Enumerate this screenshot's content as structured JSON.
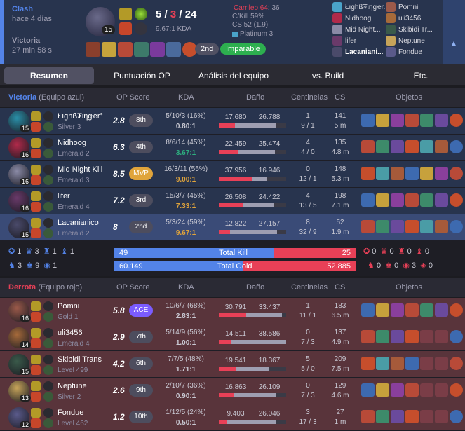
{
  "header": {
    "queue": "Clash",
    "time_ago": "hace 4 días",
    "result": "Victoria",
    "duration": "27 min 58 s",
    "kills": "5",
    "deaths": "3",
    "assists": "24",
    "kda_ratio": "9.67:1 KDA",
    "level": "15",
    "position_badge": "2nd",
    "tag": "Imparable",
    "kill_participation_label": "Carrileo 64",
    "kill_participation_value": ": 36",
    "ck": "C/Kill 59%",
    "cs": "CS 52 (1.9)",
    "rank": "Platinum 3",
    "players_left": [
      "Łıghß₮ιηgҽr...",
      "Nidhoog",
      "Mid Night...",
      "lifer",
      "Lacaniani..."
    ],
    "players_right": [
      "Pomni",
      "uli3456",
      "Skibidi Tr...",
      "Neptune",
      "Fondue"
    ]
  },
  "tabs": [
    "Resumen",
    "Puntuación OP",
    "Análisis del equipo",
    "vs. Build",
    "Etc."
  ],
  "columns": {
    "op": "OP Score",
    "kda": "KDA",
    "damage": "Daño",
    "wards": "Centinelas",
    "cs": "CS",
    "items": "Objetos"
  },
  "blue_team": {
    "label": "Victoria",
    "sub": "(Equipo azul)",
    "players": [
      {
        "name": "Łıghß₮ιηgҽr°",
        "rank": "Silver 3",
        "level": "15",
        "score": "2.8",
        "badge": "8th",
        "kda": "5/10/3 (16%)",
        "ratio": "0.80:1",
        "dealt": "17.680",
        "taken": "26.788",
        "dealt_pct": 0.47,
        "taken_pct": 0.71,
        "wards": "1",
        "wards2": "9 / 1",
        "cs": "141",
        "cspm": "5 m"
      },
      {
        "name": "Nidhoog",
        "rank": "Emerald 2",
        "level": "16",
        "score": "6.3",
        "badge": "4th",
        "kda": "8/6/14 (45%)",
        "ratio": "3.67:1",
        "dealt": "22.459",
        "taken": "25.474",
        "dealt_pct": 0.59,
        "taken_pct": 0.66,
        "wards": "4",
        "wards2": "4 / 0",
        "cs": "135",
        "cspm": "4.8 m"
      },
      {
        "name": "Mid Night Kill",
        "rank": "Emerald 3",
        "level": "16",
        "score": "8.5",
        "badge": "MVP",
        "kda": "16/3/11 (55%)",
        "ratio": "9.00:1",
        "dealt": "37.956",
        "taken": "16.946",
        "dealt_pct": 1.0,
        "taken_pct": 0.44,
        "wards": "0",
        "wards2": "12 / 1",
        "cs": "148",
        "cspm": "5.3 m"
      },
      {
        "name": "lifer",
        "rank": "Emerald 4",
        "level": "16",
        "score": "7.2",
        "badge": "3rd",
        "kda": "15/3/7 (45%)",
        "ratio": "7.33:1",
        "dealt": "26.508",
        "taken": "24.422",
        "dealt_pct": 0.7,
        "taken_pct": 0.64,
        "wards": "4",
        "wards2": "13 / 5",
        "cs": "198",
        "cspm": "7.1 m"
      },
      {
        "name": "Lacanianico",
        "rank": "Emerald 2",
        "level": "15",
        "score": "8",
        "badge": "2nd",
        "kda": "5/3/24 (59%)",
        "ratio": "9.67:1",
        "dealt": "12.822",
        "taken": "27.157",
        "dealt_pct": 0.34,
        "taken_pct": 0.72,
        "wards": "8",
        "wards2": "32 / 9",
        "cs": "52",
        "cspm": "1.9 m"
      }
    ]
  },
  "summary": {
    "total_kill_label": "Total Kill",
    "blue_kills": "49",
    "red_kills": "25",
    "kill_ratio": 0.662,
    "total_gold_label": "Total Gold",
    "blue_gold": "60.149",
    "red_gold": "52.885",
    "gold_ratio": 0.532,
    "blue_obj_top": [
      "1",
      "3",
      "1",
      "1"
    ],
    "blue_obj_bot": [
      "3",
      "9",
      "1"
    ],
    "red_obj_top": [
      "0",
      "0",
      "0",
      "0"
    ],
    "red_obj_bot": [
      "0",
      "0",
      "3",
      "0"
    ]
  },
  "red_team": {
    "label": "Derrota",
    "sub": "(Equipo rojo)",
    "players": [
      {
        "name": "Pomni",
        "rank": "Gold 1",
        "level": "16",
        "score": "5.8",
        "badge": "ACE",
        "kda": "10/6/7 (68%)",
        "ratio": "2.83:1",
        "dealt": "30.791",
        "taken": "33.437",
        "dealt_pct": 0.81,
        "taken_pct": 0.88,
        "wards": "1",
        "wards2": "11 / 1",
        "cs": "183",
        "cspm": "6.5 m"
      },
      {
        "name": "uli3456",
        "rank": "Emerald 4",
        "level": "14",
        "score": "2.9",
        "badge": "7th",
        "kda": "5/14/9 (56%)",
        "ratio": "1.00:1",
        "dealt": "14.511",
        "taken": "38.586",
        "dealt_pct": 0.38,
        "taken_pct": 1.0,
        "wards": "0",
        "wards2": "7 / 3",
        "cs": "137",
        "cspm": "4.9 m"
      },
      {
        "name": "Skibidi Trans",
        "rank": "Level 499",
        "level": "15",
        "score": "4.2",
        "badge": "6th",
        "kda": "7/7/5 (48%)",
        "ratio": "1.71:1",
        "dealt": "19.541",
        "taken": "18.367",
        "dealt_pct": 0.51,
        "taken_pct": 0.48,
        "wards": "5",
        "wards2": "5 / 0",
        "cs": "209",
        "cspm": "7.5 m"
      },
      {
        "name": "Neptune",
        "rank": "Silver 2",
        "level": "13",
        "score": "2.6",
        "badge": "9th",
        "kda": "2/10/7 (36%)",
        "ratio": "0.90:1",
        "dealt": "16.863",
        "taken": "26.109",
        "dealt_pct": 0.44,
        "taken_pct": 0.68,
        "wards": "0",
        "wards2": "7 / 3",
        "cs": "129",
        "cspm": "4.6 m"
      },
      {
        "name": "Fondue",
        "rank": "Level 462",
        "level": "12",
        "score": "1.2",
        "badge": "10th",
        "kda": "1/12/5 (24%)",
        "ratio": "0.50:1",
        "dealt": "9.403",
        "taken": "26.046",
        "dealt_pct": 0.25,
        "taken_pct": 0.68,
        "wards": "3",
        "wards2": "17 / 3",
        "cs": "27",
        "cspm": "1 m"
      }
    ]
  },
  "colors": {
    "blue": "#5383e8",
    "red": "#e84057",
    "mvp": "#e0a43b",
    "gold_ratio": "#e0a43b",
    "green_ratio": "#2daf7f"
  }
}
